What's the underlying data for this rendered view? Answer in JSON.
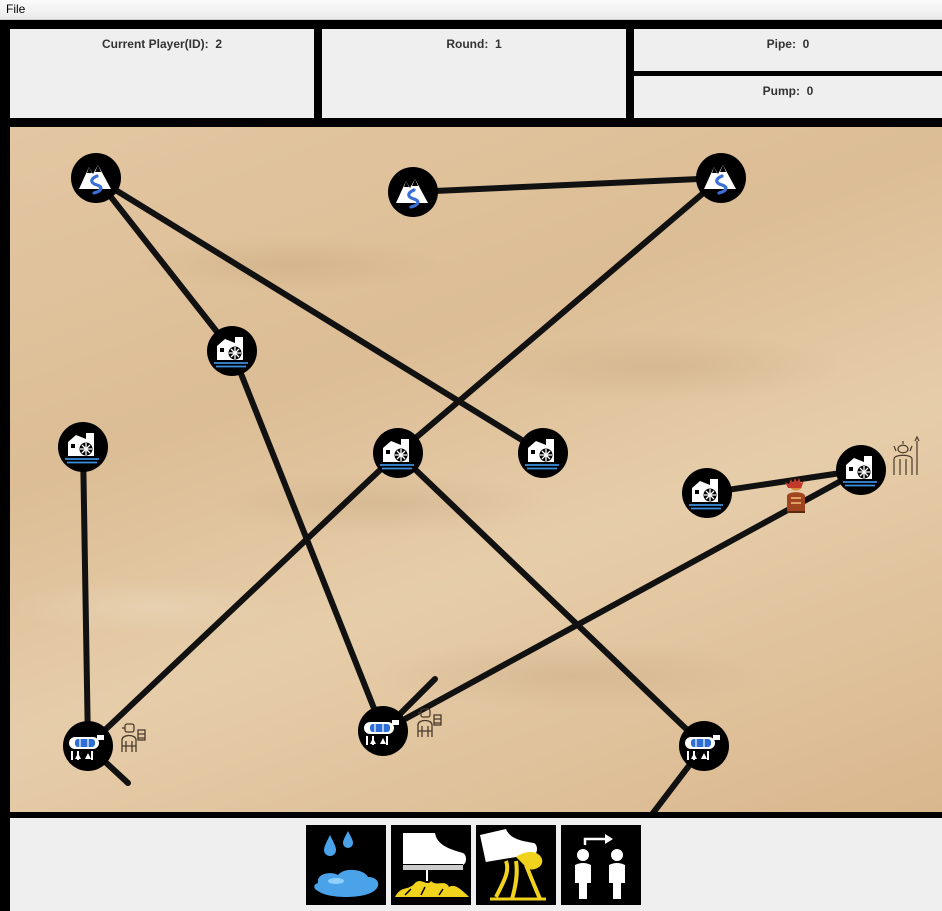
{
  "menu": {
    "file_label": "File"
  },
  "status": {
    "current_player_label": "Current Player(ID):",
    "current_player_value": "2",
    "round_label": "Round:",
    "round_value": "1",
    "pipe_label": "Pipe:",
    "pipe_value": "0",
    "pump_label": "Pump:",
    "pump_value": "0"
  },
  "board": {
    "background": "desert-sand",
    "pipe_color": "#111111",
    "nodes": [
      {
        "id": "spring-1",
        "kind": "spring",
        "icon": "mountain-spring-icon"
      },
      {
        "id": "spring-2",
        "kind": "spring",
        "icon": "mountain-spring-icon"
      },
      {
        "id": "spring-3",
        "kind": "spring",
        "icon": "mountain-spring-icon"
      },
      {
        "id": "pump-1",
        "kind": "pump",
        "icon": "pump-station-icon"
      },
      {
        "id": "pump-2",
        "kind": "pump",
        "icon": "pump-station-icon"
      },
      {
        "id": "pump-3",
        "kind": "pump",
        "icon": "pump-station-icon"
      },
      {
        "id": "pump-4",
        "kind": "pump",
        "icon": "pump-station-icon"
      },
      {
        "id": "pump-5",
        "kind": "pump",
        "icon": "pump-station-icon"
      },
      {
        "id": "pump-6",
        "kind": "pump",
        "icon": "pump-station-icon"
      },
      {
        "id": "cistern-1",
        "kind": "cistern",
        "icon": "cistern-tank-icon"
      },
      {
        "id": "cistern-2",
        "kind": "cistern",
        "icon": "cistern-tank-icon"
      },
      {
        "id": "cistern-3",
        "kind": "cistern",
        "icon": "cistern-tank-icon"
      }
    ],
    "players": [
      {
        "id": "plumber-1",
        "icon": "plumber-icon"
      },
      {
        "id": "plumber-2",
        "icon": "plumber-icon"
      },
      {
        "id": "saboteur-1",
        "icon": "saboteur-icon"
      },
      {
        "id": "saboteur-2",
        "icon": "saboteur-icon"
      }
    ]
  },
  "actions": [
    {
      "name": "leak-action",
      "icon": "water-leak-icon"
    },
    {
      "name": "step-action",
      "icon": "boot-step-icon"
    },
    {
      "name": "sticky-action",
      "icon": "boot-sticky-icon"
    },
    {
      "name": "move-action",
      "icon": "move-player-icon"
    }
  ]
}
